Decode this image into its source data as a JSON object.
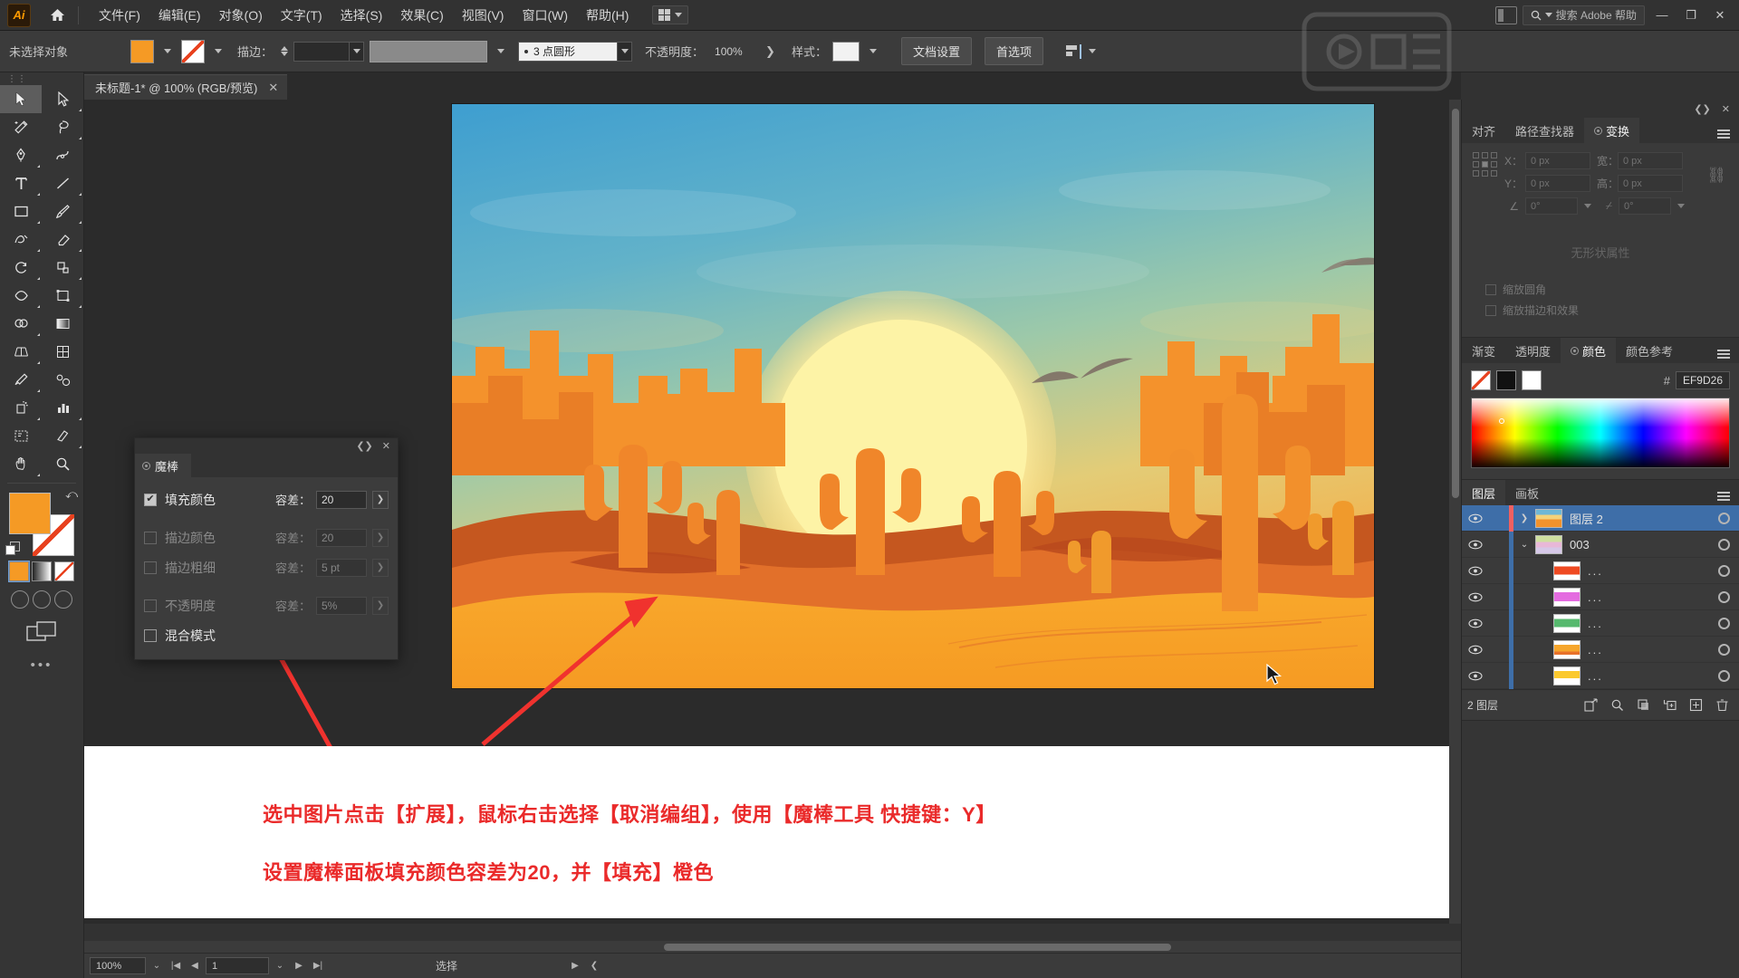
{
  "app": {
    "logo": "Ai",
    "home_icon": "home-icon"
  },
  "menubar": {
    "items": [
      "文件(F)",
      "编辑(E)",
      "对象(O)",
      "文字(T)",
      "选择(S)",
      "效果(C)",
      "视图(V)",
      "窗口(W)",
      "帮助(H)"
    ],
    "workspace_switcher": "workspace-grid-icon",
    "search_placeholder": "搜索 Adobe 帮助",
    "window_buttons": [
      "—",
      "❐",
      "✕"
    ]
  },
  "controlbar": {
    "selection_status": "未选择对象",
    "fill_color": "#F59A25",
    "stroke_color": "none",
    "stroke_label": "描边：",
    "stroke_weight": "",
    "profile_label": "",
    "brush_label": "3 点圆形",
    "opacity_label": "不透明度：",
    "opacity_value": "100%",
    "style_label": "样式：",
    "doc_setup_button": "文档设置",
    "preferences_button": "首选项",
    "align_icon": "align-icon"
  },
  "document_tab": {
    "title": "未标题-1* @ 100% (RGB/预览)",
    "close": "✕"
  },
  "toolbar": {
    "tools": [
      "selection-tool",
      "direct-selection-tool",
      "magic-wand-tool",
      "lasso-tool",
      "pen-tool",
      "curvature-tool",
      "type-tool",
      "line-segment-tool",
      "rectangle-tool",
      "paintbrush-tool",
      "shaper-tool",
      "eraser-tool",
      "rotate-tool",
      "scale-tool",
      "width-tool",
      "free-transform-tool",
      "shape-builder-tool",
      "gradient-tool",
      "perspective-grid-tool",
      "mesh-tool",
      "eyedropper-tool",
      "blend-tool",
      "symbol-sprayer-tool",
      "column-graph-tool",
      "artboard-tool",
      "slice-tool",
      "hand-tool",
      "zoom-tool"
    ],
    "fill_color": "#F59A25",
    "stroke_color": "#FFFFFF",
    "modes": [
      "color-mode",
      "gradient-mode",
      "none-mode"
    ],
    "screen_modes": [
      "draw-normal",
      "draw-behind",
      "draw-inside"
    ],
    "more_tools": "•••"
  },
  "magic_wand_panel": {
    "title": "魔棒",
    "collapse_icon": "collapse-icon",
    "close_icon": "✕",
    "rows": [
      {
        "label": "填充颜色",
        "checked": true,
        "tol_label": "容差：",
        "tol_value": "20",
        "dim": false
      },
      {
        "label": "描边颜色",
        "checked": false,
        "tol_label": "容差：",
        "tol_value": "20",
        "dim": true
      },
      {
        "label": "描边粗细",
        "checked": false,
        "tol_label": "容差：",
        "tol_value": "5 pt",
        "dim": true
      },
      {
        "label": "不透明度",
        "checked": false,
        "tol_label": "容差：",
        "tol_value": "5%",
        "dim": true
      },
      {
        "label": "混合模式",
        "checked": false,
        "tol_label": "",
        "tol_value": "",
        "dim": false
      }
    ]
  },
  "right_dock": {
    "transform_group": {
      "tabs": [
        "对齐",
        "路径查找器",
        "变换"
      ],
      "active_tab": "变换",
      "fields": [
        {
          "label": "X：",
          "value": "0 px"
        },
        {
          "label": "宽：",
          "value": "0 px"
        },
        {
          "label": "Y：",
          "value": "0 px"
        },
        {
          "label": "高：",
          "value": "0 px"
        }
      ],
      "angle_value": "0°",
      "shear_value": "0°",
      "empty_text": "无形状属性",
      "checkboxes": [
        "缩放圆角",
        "缩放描边和效果"
      ]
    },
    "color_group": {
      "tabs": [
        "渐变",
        "透明度",
        "颜色",
        "颜色参考"
      ],
      "active_tab": "颜色",
      "hash": "#",
      "hex_value": "EF9D26",
      "swatches": [
        "none-swatch",
        "black-swatch",
        "white-swatch"
      ]
    },
    "layers_group": {
      "tabs": [
        "图层",
        "画板"
      ],
      "active_tab": "图层",
      "rows": [
        {
          "name": "图层 2",
          "type": "layer",
          "selected": true,
          "expanded": false,
          "color": "#f06060",
          "thumb": "sunset-thumb"
        },
        {
          "name": "003",
          "type": "group",
          "selected": false,
          "expanded": true,
          "color": "#3e6ea8",
          "thumb": "art-thumb"
        },
        {
          "name": "...",
          "type": "path",
          "selected": false,
          "expanded": null,
          "color": "#3e6ea8",
          "thumb": "red-thumb"
        },
        {
          "name": "...",
          "type": "path",
          "selected": false,
          "expanded": null,
          "color": "#3e6ea8",
          "thumb": "magenta-thumb"
        },
        {
          "name": "...",
          "type": "path",
          "selected": false,
          "expanded": null,
          "color": "#3e6ea8",
          "thumb": "green-thumb"
        },
        {
          "name": "...",
          "type": "path",
          "selected": false,
          "expanded": null,
          "color": "#3e6ea8",
          "thumb": "orange-thumb"
        },
        {
          "name": "...",
          "type": "path",
          "selected": false,
          "expanded": null,
          "color": "#3e6ea8",
          "thumb": "yellow-thumb"
        }
      ],
      "footer_count": "2 图层",
      "footer_buttons": [
        "release-to-layers",
        "locate-object",
        "make-clipping-mask",
        "create-sublayer",
        "create-layer",
        "delete-layer"
      ]
    }
  },
  "annotation": {
    "line1": "选中图片点击【扩展】，鼠标右击选择【取消编组】，使用【魔棒工具 快捷键：Y】",
    "line2": "设置魔棒面板填充颜色容差为20，并【填充】橙色",
    "color": "#EA2A2A"
  },
  "statusbar": {
    "zoom": "100%",
    "page": "1",
    "status_text": "选择",
    "nav_first": "|◀",
    "nav_prev": "◀",
    "nav_next": "▶",
    "nav_last": "▶|"
  },
  "canvas": {
    "artwork_title": "desert-sunset-illustration",
    "sky_top": "#3C9FD1",
    "sky_mid": "#8CC4B4",
    "sun_color": "#FFF4A8",
    "dune_front": "#F6A129",
    "dune_mid": "#E8712A",
    "dune_back": "#B9461E"
  }
}
